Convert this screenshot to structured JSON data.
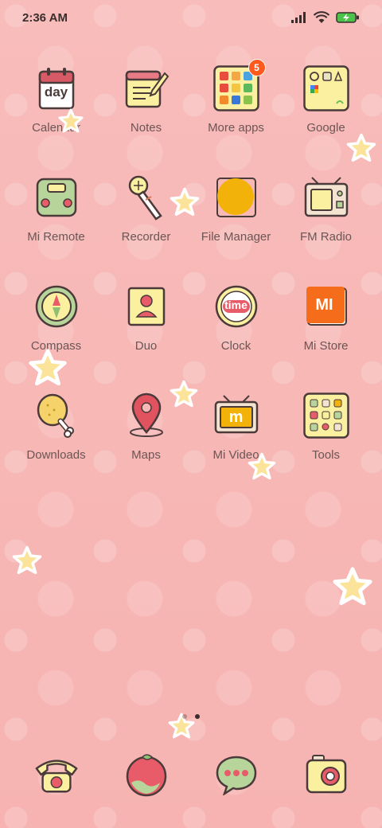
{
  "status_bar": {
    "time": "2:36 AM"
  },
  "apps": [
    {
      "label": "Calendar",
      "icon": "calendar-day-icon",
      "icon_text": "day"
    },
    {
      "label": "Notes",
      "icon": "notes-pencil-icon"
    },
    {
      "label": "More apps",
      "icon": "folder-more-apps-icon",
      "badge": "5"
    },
    {
      "label": "Google",
      "icon": "folder-google-icon"
    },
    {
      "label": "Mi Remote",
      "icon": "remote-icon"
    },
    {
      "label": "Recorder",
      "icon": "microphone-icon"
    },
    {
      "label": "File Manager",
      "icon": "file-manager-icon"
    },
    {
      "label": "FM Radio",
      "icon": "radio-icon"
    },
    {
      "label": "Compass",
      "icon": "compass-icon"
    },
    {
      "label": "Duo",
      "icon": "duo-person-icon"
    },
    {
      "label": "Clock",
      "icon": "clock-time-icon",
      "icon_text": "time"
    },
    {
      "label": "Mi Store",
      "icon": "mi-store-icon",
      "icon_text": "MI"
    },
    {
      "label": "Downloads",
      "icon": "drumstick-icon"
    },
    {
      "label": "Maps",
      "icon": "map-pin-icon"
    },
    {
      "label": "Mi Video",
      "icon": "tv-icon",
      "icon_text": "m"
    },
    {
      "label": "Tools",
      "icon": "tools-folder-icon"
    }
  ],
  "dock": [
    {
      "name": "phone",
      "icon": "phone-icon"
    },
    {
      "name": "contacts",
      "icon": "globe-fruit-icon"
    },
    {
      "name": "messages",
      "icon": "message-bubble-icon"
    },
    {
      "name": "camera",
      "icon": "camera-icon"
    }
  ],
  "colors": {
    "background": "#f7b8b6",
    "label_text": "#6b5656",
    "badge": "#ff5a1e",
    "icon_outline": "#4a3a3a",
    "icon_yellow": "#fbefa0",
    "icon_green": "#b7d59a"
  },
  "page_indicator": {
    "pages": 2,
    "active": 1
  }
}
